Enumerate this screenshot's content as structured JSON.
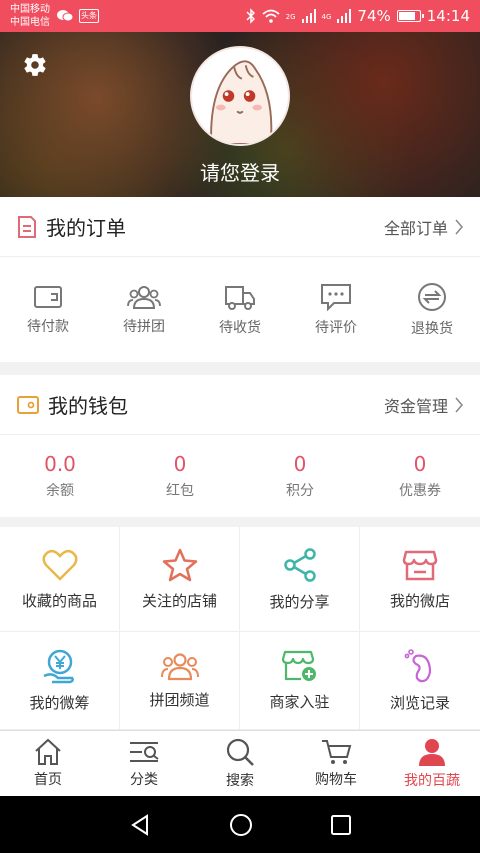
{
  "status_bar": {
    "carrier1": "中国移动",
    "carrier2": "中国电信",
    "battery": "74%",
    "battery_level": 0.74,
    "time": "14:14",
    "net1": "2G",
    "net2": "4G",
    "notif_badge": "头条"
  },
  "header": {
    "login_text": "请您登录",
    "bg_color": "#2a2220"
  },
  "orders": {
    "title": "我的订单",
    "more": "全部订单",
    "items": [
      {
        "label": "待付款",
        "icon": "wallet-icon"
      },
      {
        "label": "待拼团",
        "icon": "group-icon"
      },
      {
        "label": "待收货",
        "icon": "truck-icon"
      },
      {
        "label": "待评价",
        "icon": "comment-icon"
      },
      {
        "label": "退换货",
        "icon": "exchange-icon"
      }
    ]
  },
  "wallet": {
    "title": "我的钱包",
    "more": "资金管理",
    "items": [
      {
        "value": "0.0",
        "label": "余额"
      },
      {
        "value": "0",
        "label": "红包"
      },
      {
        "value": "0",
        "label": "积分"
      },
      {
        "value": "0",
        "label": "优惠券"
      }
    ]
  },
  "services": [
    {
      "label": "收藏的商品",
      "icon": "heart-icon",
      "color": "#e8b84a"
    },
    {
      "label": "关注的店铺",
      "icon": "star-icon",
      "color": "#e2705a"
    },
    {
      "label": "我的分享",
      "icon": "share-icon",
      "color": "#3fb5a8"
    },
    {
      "label": "我的微店",
      "icon": "shop-icon",
      "color": "#e06a78"
    },
    {
      "label": "我的微筹",
      "icon": "yen-hand-icon",
      "color": "#3fa6d6"
    },
    {
      "label": "拼团频道",
      "icon": "group-channel-icon",
      "color": "#e88a5a"
    },
    {
      "label": "商家入驻",
      "icon": "store-add-icon",
      "color": "#4db86a"
    },
    {
      "label": "浏览记录",
      "icon": "footprint-icon",
      "color": "#c865d6"
    }
  ],
  "tabs": [
    {
      "label": "首页",
      "icon": "home-icon"
    },
    {
      "label": "分类",
      "icon": "category-icon"
    },
    {
      "label": "搜索",
      "icon": "search-icon"
    },
    {
      "label": "购物车",
      "icon": "cart-icon"
    },
    {
      "label": "我的百蔬",
      "icon": "user-icon"
    }
  ],
  "colors": {
    "accent": "#f04e5e",
    "active_tab": "#e0464f",
    "value_red": "#e05565"
  }
}
